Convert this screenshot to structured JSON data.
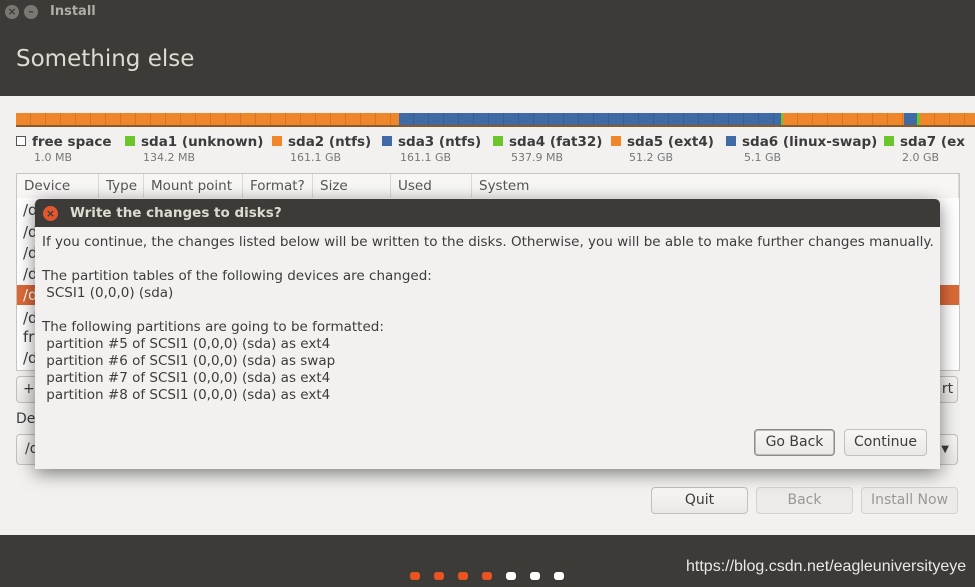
{
  "window": {
    "title": "Install"
  },
  "header": {
    "title": "Something else"
  },
  "partition_bar": {
    "segments": [
      {
        "color": "#f0862a",
        "share": 0.399
      },
      {
        "color": "#3f6aa5",
        "share": 0.399
      },
      {
        "color": "#6cc52a",
        "share": 0.002
      },
      {
        "color": "#f0862a",
        "share": 0.126
      },
      {
        "color": "#3f6aa5",
        "share": 0.014
      },
      {
        "color": "#6cc52a",
        "share": 0.003
      },
      {
        "color": "#f0862a",
        "share": 0.057
      }
    ]
  },
  "legend": [
    {
      "label": "free space",
      "size": "1.0 MB",
      "color": "#ffffff"
    },
    {
      "label": "sda1 (unknown)",
      "size": "134.2 MB",
      "color": "#6cc52a"
    },
    {
      "label": "sda2 (ntfs)",
      "size": "161.1 GB",
      "color": "#f0862a"
    },
    {
      "label": "sda3 (ntfs)",
      "size": "161.1 GB",
      "color": "#3f6aa5"
    },
    {
      "label": "sda4 (fat32)",
      "size": "537.9 MB",
      "color": "#6cc52a"
    },
    {
      "label": "sda5 (ext4)",
      "size": "51.2 GB",
      "color": "#f0862a"
    },
    {
      "label": "sda6 (linux-swap)",
      "size": "5.1 GB",
      "color": "#3f6aa5"
    },
    {
      "label": "sda7 (ex",
      "size": "2.0 GB",
      "color": "#6cc52a"
    }
  ],
  "table": {
    "columns": [
      "Device",
      "Type",
      "Mount point",
      "Format?",
      "Size",
      "Used",
      "System"
    ],
    "rows": [
      "/d",
      "/d",
      "/d",
      "/d",
      "/d",
      "/d",
      "fr",
      "/d"
    ]
  },
  "controls": {
    "add": "+",
    "change_partial": "rt",
    "device_label_partial": "De",
    "bootloader_partial": "/d"
  },
  "footer": {
    "quit": "Quit",
    "back": "Back",
    "install_now": "Install Now"
  },
  "dialog": {
    "title": "Write the changes to disks?",
    "intro": "If you continue, the changes listed below will be written to the disks. Otherwise, you will be able to make further changes manually.",
    "tables_heading": "The partition tables of the following devices are changed:",
    "tables": [
      " SCSI1 (0,0,0) (sda)"
    ],
    "format_heading": "The following partitions are going to be formatted:",
    "format": [
      " partition #5 of SCSI1 (0,0,0) (sda) as ext4",
      " partition #6 of SCSI1 (0,0,0) (sda) as swap",
      " partition #7 of SCSI1 (0,0,0) (sda) as ext4",
      " partition #8 of SCSI1 (0,0,0) (sda) as ext4"
    ],
    "go_back": "Go Back",
    "continue": "Continue"
  },
  "progress": {
    "steps_done": 4,
    "steps_total": 7,
    "active_color": "#e95420",
    "pending_color": "#ffffff"
  },
  "watermark": "https://blog.csdn.net/eagleuniversityeye"
}
